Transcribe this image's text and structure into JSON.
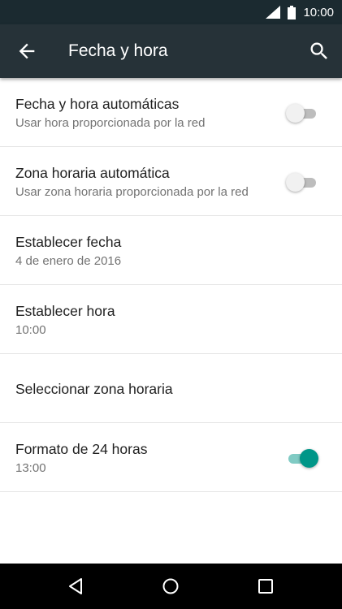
{
  "status_bar": {
    "time": "10:00",
    "icons": [
      "signal-icon",
      "battery-icon"
    ]
  },
  "app_bar": {
    "title": "Fecha y hora",
    "back_icon": "arrow-back-icon",
    "search_icon": "search-icon"
  },
  "settings": [
    {
      "title": "Fecha y hora automáticas",
      "summary": "Usar hora proporcionada por la red",
      "switch": "off"
    },
    {
      "title": "Zona horaria automática",
      "summary": "Usar zona horaria proporcionada por la red",
      "switch": "off"
    },
    {
      "title": "Establecer fecha",
      "summary": "4 de enero de 2016"
    },
    {
      "title": "Establecer hora",
      "summary": "10:00"
    },
    {
      "title": "Seleccionar zona horaria"
    },
    {
      "title": "Formato de 24 horas",
      "summary": "13:00",
      "switch": "on"
    }
  ],
  "nav_bar": {
    "icons": [
      "back-triangle-icon",
      "home-circle-icon",
      "recents-square-icon"
    ]
  },
  "colors": {
    "status_bar": "#1b2a30",
    "app_bar": "#263238",
    "accent": "#009688"
  }
}
